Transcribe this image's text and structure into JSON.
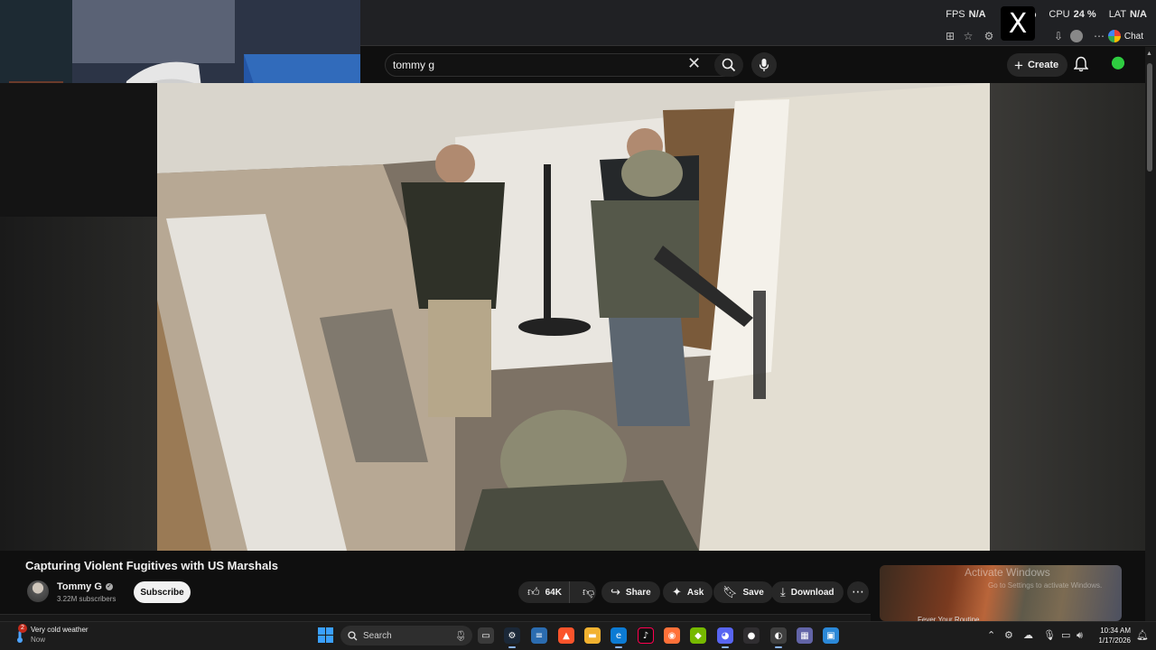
{
  "overlay": {
    "fps_label": "FPS",
    "fps_value": "N/A",
    "gpu_value": "%",
    "cpu_label": "CPU",
    "cpu_value": "24 %",
    "lat_label": "LAT",
    "lat_value": "N/A",
    "x_logo": "X"
  },
  "browser": {
    "chat_label": "Chat"
  },
  "youtube": {
    "search_value": "tommy g",
    "create_label": "Create"
  },
  "video": {
    "title": "Capturing Violent Fugitives with US Marshals",
    "channel_name": "Tommy G",
    "subscribers": "3.22M subscribers",
    "subscribe_label": "Subscribe",
    "like_count": "64K",
    "share_label": "Share",
    "ask_label": "Ask",
    "save_label": "Save",
    "download_label": "Download"
  },
  "recommendation": {
    "caption": "Fever Your Routine",
    "watermark_title": "Activate Windows",
    "watermark_sub": "Go to Settings to activate Windows."
  },
  "taskbar": {
    "weather_title": "Very cold weather",
    "weather_sub": "Now",
    "weather_badge": "2",
    "search_placeholder": "Search",
    "time": "10:34 AM",
    "date": "1/17/2026",
    "apps": [
      "start-menu",
      "search",
      "file-explorer",
      "steam",
      "notepad",
      "brave",
      "folder",
      "edge",
      "tiktok",
      "firefox",
      "nvidia",
      "discord",
      "obs",
      "spotify",
      "teams",
      "settings"
    ]
  },
  "colors": {
    "background": "#0f0f0f",
    "chip": "#272727",
    "subscribe_bg": "#f1f1f1",
    "accent_blue": "#3aa0ff"
  }
}
